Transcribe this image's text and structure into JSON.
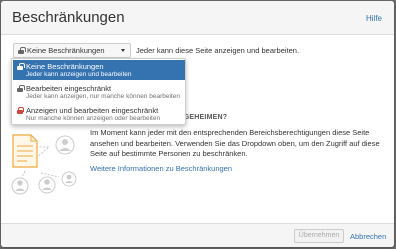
{
  "dialog": {
    "title": "Beschränkungen",
    "help_link": "Hilfe"
  },
  "restriction": {
    "selected_label": "Keine Beschränkungen",
    "description": "Jeder kann diese Seite anzeigen und bearbeiten."
  },
  "dropdown": {
    "items": [
      {
        "label": "Keine Beschränkungen",
        "sub": "Jeder kann anzeigen und bearbeiten",
        "icon": "unlocked-icon",
        "selected": true
      },
      {
        "label": "Bearbeiten eingeschränkt",
        "sub": "Jeder kann anzeigen, nur manche können bearbeiten",
        "icon": "unlocked-icon",
        "selected": false
      },
      {
        "label": "Anzeigen und bearbeiten eingeschränkt",
        "sub": "Nur manche können anzeigen oder bearbeiten",
        "icon": "locked-icon",
        "selected": false
      }
    ]
  },
  "info": {
    "heading_partial": "G GEHEIMEN?",
    "body": "Im Moment kann jeder mit den entsprechenden Bereichsberechtigungen diese Seite ansehen und bearbeiten. Verwenden Sie das Dropdown oben, um den Zugriff auf diese Seite auf bestimmte Personen zu beschränken.",
    "more_link": "Weitere Informationen zu Beschränkungen"
  },
  "footer": {
    "apply_label": "Übernehmen",
    "cancel_label": "Abbrechen"
  },
  "colors": {
    "accent": "#3572b0",
    "lock_red": "#d04437",
    "document_orange": "#f0a840"
  }
}
